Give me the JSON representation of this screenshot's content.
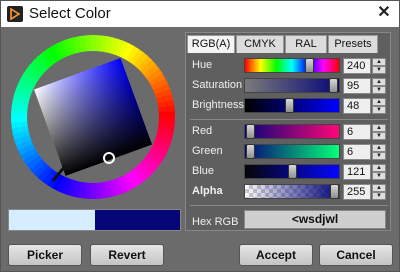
{
  "window": {
    "title": "Select Color"
  },
  "tabs": [
    {
      "label": "RGB(A)",
      "active": true
    },
    {
      "label": "CMYK",
      "active": false
    },
    {
      "label": "RAL",
      "active": false
    },
    {
      "label": "Presets",
      "active": false
    }
  ],
  "hsb": [
    {
      "label": "Hue",
      "value": "240"
    },
    {
      "label": "Saturation",
      "value": "95"
    },
    {
      "label": "Brightness",
      "value": "48"
    }
  ],
  "rgba": [
    {
      "label": "Red",
      "value": "6"
    },
    {
      "label": "Green",
      "value": "6"
    },
    {
      "label": "Blue",
      "value": "121"
    },
    {
      "label": "Alpha",
      "value": "255"
    }
  ],
  "hex": {
    "label": "Hex RGB",
    "value": "<wsdjwl"
  },
  "buttons": {
    "picker": "Picker",
    "revert": "Revert",
    "accept": "Accept",
    "cancel": "Cancel"
  },
  "colors": {
    "current": "#060679",
    "previous": "#d6ecff"
  }
}
